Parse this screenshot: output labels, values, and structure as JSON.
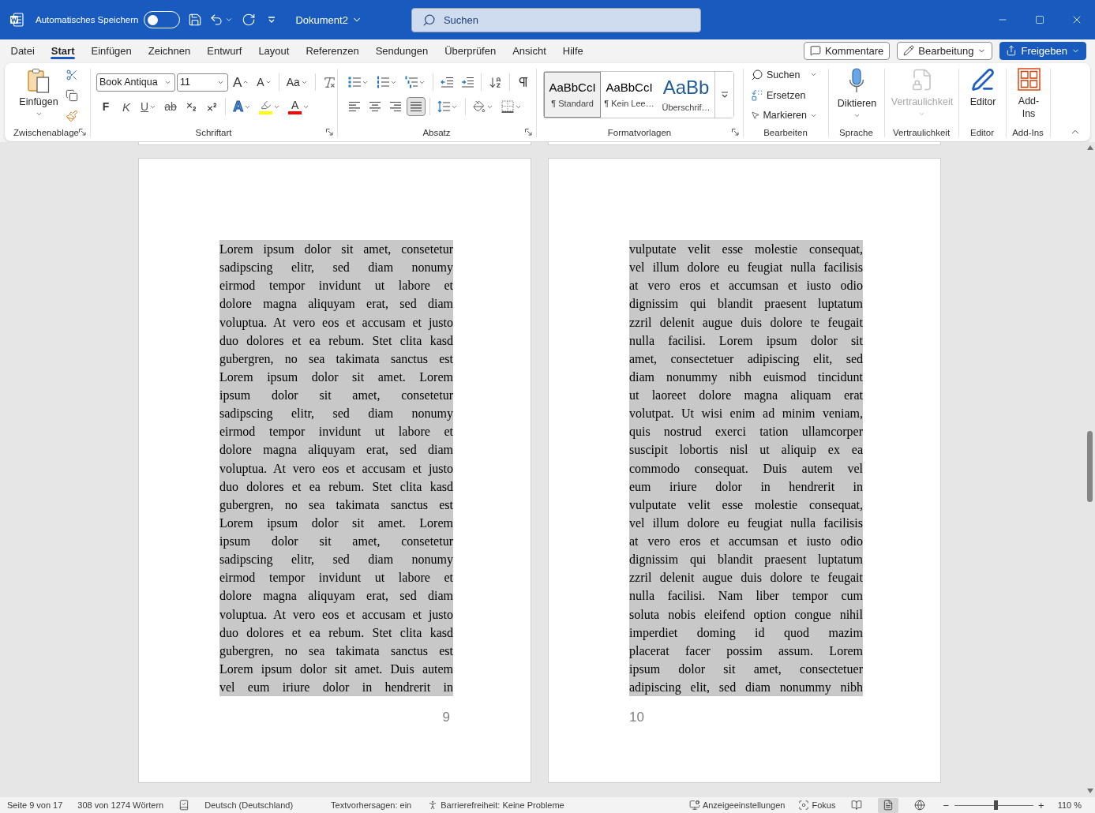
{
  "title_bar": {
    "autosave_label": "Automatisches Speichern",
    "autosave_on": false,
    "document_name": "Dokument2",
    "search": {
      "placeholder": "Suchen"
    }
  },
  "tabs": [
    {
      "label": "Datei",
      "selected": false
    },
    {
      "label": "Start",
      "selected": true
    },
    {
      "label": "Einfügen",
      "selected": false
    },
    {
      "label": "Zeichnen",
      "selected": false
    },
    {
      "label": "Entwurf",
      "selected": false
    },
    {
      "label": "Layout",
      "selected": false
    },
    {
      "label": "Referenzen",
      "selected": false
    },
    {
      "label": "Sendungen",
      "selected": false
    },
    {
      "label": "Überprüfen",
      "selected": false
    },
    {
      "label": "Ansicht",
      "selected": false
    },
    {
      "label": "Hilfe",
      "selected": false
    }
  ],
  "header_buttons": [
    {
      "kind": "comments",
      "label": "Kommentare",
      "dropdown": false
    },
    {
      "kind": "editing",
      "label": "Bearbeitung",
      "dropdown": true
    },
    {
      "kind": "share",
      "label": "Freigeben",
      "dropdown": true
    }
  ],
  "ribbon": {
    "groups": [
      {
        "kind": "clipboard",
        "label": "Zwischenablage",
        "launcher": true,
        "paste_label": "Einfügen"
      },
      {
        "kind": "font",
        "label": "Schriftart",
        "launcher": true,
        "font_name": "Book Antiqua",
        "font_size": "11",
        "row1": [
          {
            "kind": "grow",
            "text": "A",
            "dropdown": false
          },
          {
            "kind": "shrink",
            "text": "A",
            "dropdown": false
          },
          {
            "kind": "case",
            "text": "Aa",
            "dropdown": true
          },
          {
            "kind": "clear",
            "dropdown": false
          }
        ],
        "row2": [
          {
            "kind": "bold",
            "text": "F",
            "dropdown": false
          },
          {
            "kind": "italic",
            "text": "K",
            "dropdown": false
          },
          {
            "kind": "underline",
            "text": "U",
            "dropdown": true
          },
          {
            "kind": "strike",
            "text": "ab",
            "dropdown": false
          },
          {
            "kind": "subscript",
            "dropdown": false
          },
          {
            "kind": "superscript",
            "dropdown": false
          },
          {
            "kind": "effects",
            "text": "A",
            "dropdown": true
          },
          {
            "kind": "highlight",
            "color": "#ffff00",
            "dropdown": true
          },
          {
            "kind": "fontcolor",
            "text": "A",
            "color": "#ff0000",
            "dropdown": true
          }
        ]
      },
      {
        "kind": "paragraph",
        "label": "Absatz",
        "launcher": true,
        "row1": [
          {
            "kind": "bullets",
            "dropdown": true
          },
          {
            "kind": "numbering",
            "dropdown": true
          },
          {
            "kind": "multilevel",
            "dropdown": true
          },
          {
            "kind": "outdent",
            "dropdown": false
          },
          {
            "kind": "indent",
            "dropdown": false
          },
          {
            "kind": "sort",
            "dropdown": false
          },
          {
            "kind": "pilcrow",
            "dropdown": false
          }
        ],
        "row2": [
          {
            "kind": "align_left",
            "selected": false,
            "dropdown": false
          },
          {
            "kind": "align_center",
            "selected": false,
            "dropdown": false
          },
          {
            "kind": "align_right",
            "selected": false,
            "dropdown": false
          },
          {
            "kind": "justify",
            "selected": true,
            "dropdown": false
          },
          {
            "kind": "line_spacing",
            "selected": false,
            "dropdown": true
          },
          {
            "kind": "shading",
            "selected": false,
            "dropdown": true
          },
          {
            "kind": "borders",
            "selected": false,
            "dropdown": true
          }
        ]
      },
      {
        "kind": "styles",
        "label": "Formatvorlagen",
        "launcher": true,
        "styles": [
          {
            "kind": "normal",
            "preview": "AaBbCcI",
            "name": "¶ Standard",
            "selected": true
          },
          {
            "kind": "normal",
            "preview": "AaBbCcI",
            "name": "¶ Kein Lee…",
            "selected": false
          },
          {
            "kind": "heading",
            "preview": "AaBb",
            "name": "Überschrif…",
            "selected": false
          }
        ]
      },
      {
        "kind": "editing",
        "label": "Bearbeiten",
        "launcher": false,
        "items": [
          {
            "kind": "search",
            "label": "Suchen",
            "dropdown": true
          },
          {
            "kind": "replace",
            "label": "Ersetzen",
            "dropdown": false
          },
          {
            "kind": "select",
            "label": "Markieren",
            "dropdown": true
          }
        ]
      },
      {
        "kind": "dictate",
        "label": "Sprache",
        "launcher": false,
        "button": {
          "label": "Diktieren",
          "dropdown": true,
          "disabled": false
        }
      },
      {
        "kind": "sensitivity",
        "label": "Vertraulichkeit",
        "launcher": false,
        "button": {
          "label": "Vertraulichkeit",
          "dropdown": true,
          "disabled": true
        }
      },
      {
        "kind": "editor",
        "label": "Editor",
        "launcher": false,
        "button": {
          "label": "Editor",
          "dropdown": false,
          "disabled": false
        }
      },
      {
        "kind": "addins",
        "label": "Add-Ins",
        "launcher": false,
        "button": {
          "label": "Add-Ins",
          "dropdown": false,
          "disabled": false
        }
      }
    ]
  },
  "document": {
    "pages": [
      {
        "selected": true,
        "page_number": "9",
        "lines": [
          "Lorem ipsum dolor sit amet, consetetur",
          "sadipscing elitr, sed diam nonumy",
          "eirmod tempor invidunt ut labore et",
          "dolore magna aliquyam erat, sed diam",
          "voluptua. At vero eos et accusam et justo",
          "duo dolores et ea rebum. Stet clita kasd",
          "gubergren, no sea takimata sanctus est",
          "Lorem ipsum dolor sit amet. Lorem",
          "ipsum dolor sit amet, consetetur",
          "sadipscing elitr, sed diam nonumy",
          "eirmod tempor invidunt ut labore et",
          "dolore magna aliquyam erat, sed diam",
          "voluptua. At vero eos et accusam et justo",
          "duo dolores et ea rebum. Stet clita kasd",
          "gubergren, no sea takimata sanctus est",
          "Lorem ipsum dolor sit amet. Lorem",
          "ipsum dolor sit amet, consetetur",
          "sadipscing elitr, sed diam nonumy",
          "eirmod tempor invidunt ut labore et",
          "dolore magna aliquyam erat, sed diam",
          "voluptua. At vero eos et accusam et justo",
          "duo dolores et ea rebum. Stet clita kasd",
          "gubergren, no sea takimata sanctus est",
          "Lorem ipsum dolor sit amet. Duis autem",
          "vel eum iriure dolor in hendrerit in"
        ]
      },
      {
        "selected": true,
        "page_number": "10",
        "lines": [
          "vulputate velit esse molestie consequat,",
          "vel illum dolore eu feugiat nulla facilisis",
          "at vero eros et accumsan et iusto odio",
          "dignissim qui blandit praesent luptatum",
          "zzril delenit augue duis dolore te feugait",
          "nulla facilisi. Lorem ipsum dolor sit",
          "amet, consectetuer adipiscing elit, sed",
          "diam nonummy nibh euismod tincidunt",
          "ut laoreet dolore magna aliquam erat",
          "volutpat. Ut wisi enim ad minim veniam,",
          "quis nostrud exerci tation ullamcorper",
          "suscipit lobortis nisl ut aliquip ex ea",
          "commodo consequat. Duis autem vel",
          "eum iriure dolor in hendrerit in",
          "vulputate velit esse molestie consequat,",
          "vel illum dolore eu feugiat nulla facilisis",
          "at vero eros et accumsan et iusto odio",
          "dignissim qui blandit praesent luptatum",
          "zzril delenit augue duis dolore te feugait",
          "nulla facilisi. Nam liber tempor cum",
          "soluta nobis eleifend option congue nihil",
          "imperdiet doming id quod mazim",
          "placerat facer possim assum. Lorem",
          "ipsum dolor sit amet, consectetuer",
          "adipiscing elit, sed diam nonummy nibh"
        ]
      }
    ]
  },
  "status_bar": {
    "items": [
      {
        "kind": "page",
        "label": "Seite 9 von 17"
      },
      {
        "kind": "words",
        "label": "308 von 1274 Wörtern"
      },
      {
        "kind": "proofing"
      },
      {
        "kind": "language",
        "label": "Deutsch (Deutschland)"
      },
      {
        "kind": "prediction",
        "label": "Textvorhersagen: ein"
      },
      {
        "kind": "accessibility",
        "label": "Barrierefreiheit: Keine Probleme"
      }
    ],
    "right_items": [
      {
        "kind": "display",
        "label": "Anzeigeeinstellungen"
      },
      {
        "kind": "focus",
        "label": "Fokus"
      }
    ],
    "views": [
      {
        "kind": "read",
        "selected": false
      },
      {
        "kind": "print",
        "selected": true
      },
      {
        "kind": "web",
        "selected": false
      }
    ],
    "zoom": {
      "minus": "−",
      "plus": "+",
      "level": 0.52,
      "reading": "110 %"
    }
  }
}
